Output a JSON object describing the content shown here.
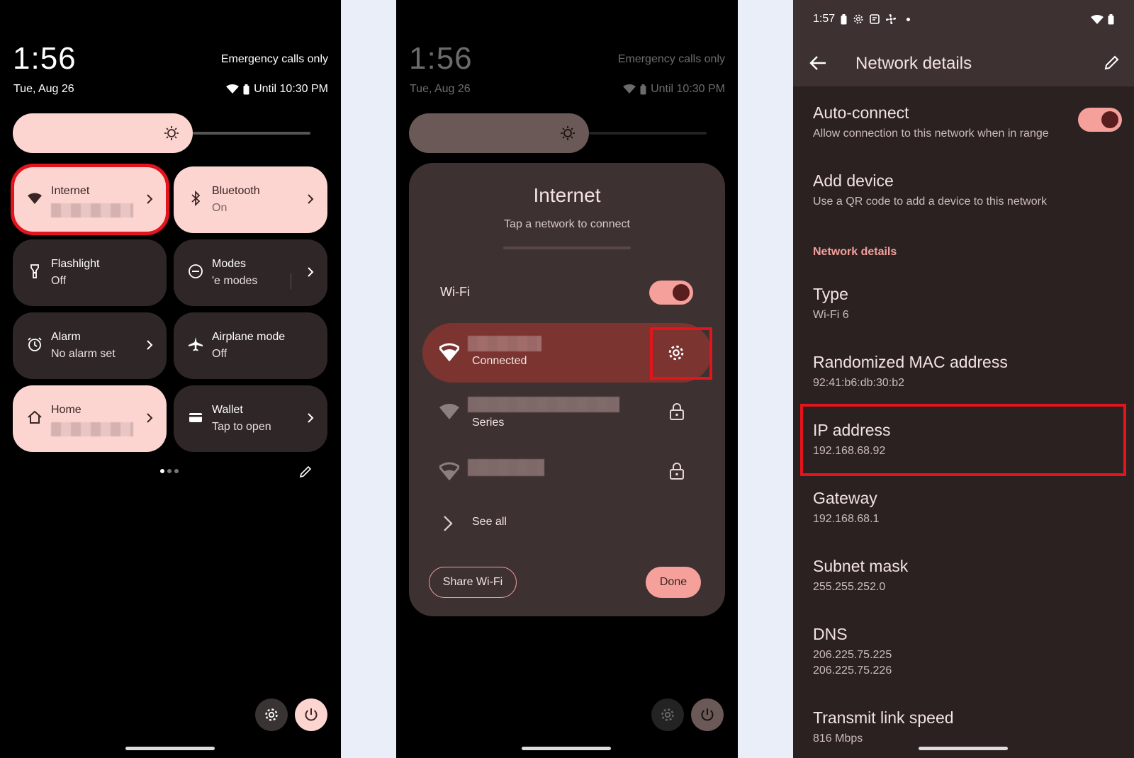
{
  "panel1": {
    "clock": "1:56",
    "date": "Tue, Aug 26",
    "carrier": "Emergency calls only",
    "battery_status": "Until 10:30 PM",
    "tiles": [
      {
        "title": "Internet",
        "subtitle": "",
        "icon": "wifi-icon"
      },
      {
        "title": "Bluetooth",
        "subtitle": "On",
        "icon": "bluetooth-icon"
      },
      {
        "title": "Flashlight",
        "subtitle": "Off",
        "icon": "flashlight-icon"
      },
      {
        "title": "Modes",
        "subtitle": "'e modes",
        "icon": "modes-icon"
      },
      {
        "title": "Alarm",
        "subtitle": "No alarm set",
        "icon": "alarm-icon"
      },
      {
        "title": "Airplane mode",
        "subtitle": "Off",
        "icon": "airplane-icon"
      },
      {
        "title": "Home",
        "subtitle": "",
        "icon": "home-icon"
      },
      {
        "title": "Wallet",
        "subtitle": "Tap to open",
        "icon": "wallet-icon"
      }
    ]
  },
  "panel2": {
    "clock": "1:56",
    "date": "Tue, Aug 26",
    "carrier": "Emergency calls only",
    "battery_status": "Until 10:30 PM",
    "dialog_title": "Internet",
    "dialog_subtitle": "Tap a network to connect",
    "wifi_label": "Wi-Fi",
    "networks": [
      {
        "status": "Connected"
      },
      {
        "status": "Series"
      },
      {
        "status": ""
      }
    ],
    "see_all": "See all",
    "share_button": "Share Wi-Fi",
    "done_button": "Done"
  },
  "panel3": {
    "status_time": "1:57",
    "header_title": "Network details",
    "auto_connect_title": "Auto-connect",
    "auto_connect_sub": "Allow connection to this network when in range",
    "add_device_title": "Add device",
    "add_device_sub": "Use a QR code to add a device to this network",
    "section_label": "Network details",
    "details": [
      {
        "title": "Type",
        "value": "Wi-Fi 6"
      },
      {
        "title": "Randomized MAC address",
        "value": "92:41:b6:db:30:b2"
      },
      {
        "title": "IP address",
        "value": "192.168.68.92"
      },
      {
        "title": "Gateway",
        "value": "192.168.68.1"
      },
      {
        "title": "Subnet mask",
        "value": "255.255.252.0"
      },
      {
        "title": "DNS",
        "value": "206.225.75.225",
        "value2": "206.225.75.226"
      },
      {
        "title": "Transmit link speed",
        "value": "816 Mbps"
      }
    ]
  },
  "colors": {
    "tile_light": "#fcd5d0",
    "tile_dark": "#2f2727",
    "accent": "#f5a09b",
    "highlight": "#e3141b",
    "section_accent": "#f2a19c"
  }
}
